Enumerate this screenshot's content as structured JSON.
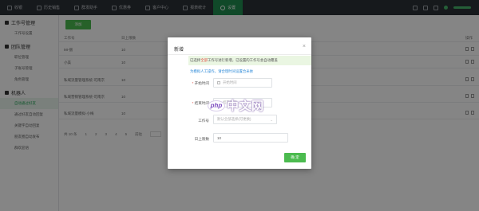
{
  "nav": {
    "items": [
      {
        "label": "收银",
        "icon": "cashier-icon"
      },
      {
        "label": "历史销售",
        "icon": "history-icon"
      },
      {
        "label": "群发助手",
        "icon": "broadcast-icon"
      },
      {
        "label": "优惠券",
        "icon": "coupon-icon"
      },
      {
        "label": "客户中心",
        "icon": "user-icon"
      },
      {
        "label": "报表统计",
        "icon": "report-icon"
      },
      {
        "label": "设置",
        "icon": "settings-icon"
      }
    ],
    "active_index": 6
  },
  "sidebar": {
    "groups": [
      {
        "title": "工作号管理",
        "icon": "wechat-icon",
        "items": [
          "工作号设置"
        ]
      },
      {
        "title": "团队管理",
        "icon": "team-icon",
        "items": [
          "职位管理",
          "子账号管理",
          "角色管理"
        ]
      },
      {
        "title": "机器人",
        "icon": "robot-icon",
        "items": [
          "自动通过好友",
          "通过好友自动回复",
          "关键字自动回复",
          "朋友圈自动发布",
          "群欢迎语"
        ]
      }
    ]
  },
  "main": {
    "add_button": "添加",
    "columns": [
      "工作号",
      "日上限数",
      "操作"
    ],
    "rows": [
      {
        "account": "MI-丽",
        "limit": "10"
      },
      {
        "account": "小美",
        "limit": "10"
      },
      {
        "account": "私域流量管理系统-可南京",
        "limit": "10"
      },
      {
        "account": "私域营销管理系统-可南京",
        "limit": "10"
      },
      {
        "account": "私域流量模拟-小梅",
        "limit": "10"
      }
    ],
    "pager": {
      "total": "共 10 条",
      "pages": [
        "1",
        "2",
        "3",
        "4",
        "5"
      ],
      "goto": "前往"
    }
  },
  "modal": {
    "title": "新增",
    "close": "×",
    "tip_prefix": "已选择",
    "tip_em": "全部",
    "tip_rest": "工作号进行新增，已设置的工作号会自动覆盖",
    "tip2": "为模拟人工操作，请合理时间设置合米依",
    "start_label": "开始时间",
    "start_placeholder": "开始时间",
    "end_label": "结束时间",
    "end_placeholder": "结束时间",
    "account_label": "工作号",
    "account_placeholder": "默认全部选择(可更换)",
    "limit_label": "日上限数",
    "limit_value": "10",
    "confirm": "确 定"
  },
  "watermark": {
    "logo": "php",
    "text": "中文网"
  },
  "colors": {
    "accent": "#4cbb4f",
    "topbar": "#2b3036",
    "nav_active": "#1f8d4f"
  }
}
